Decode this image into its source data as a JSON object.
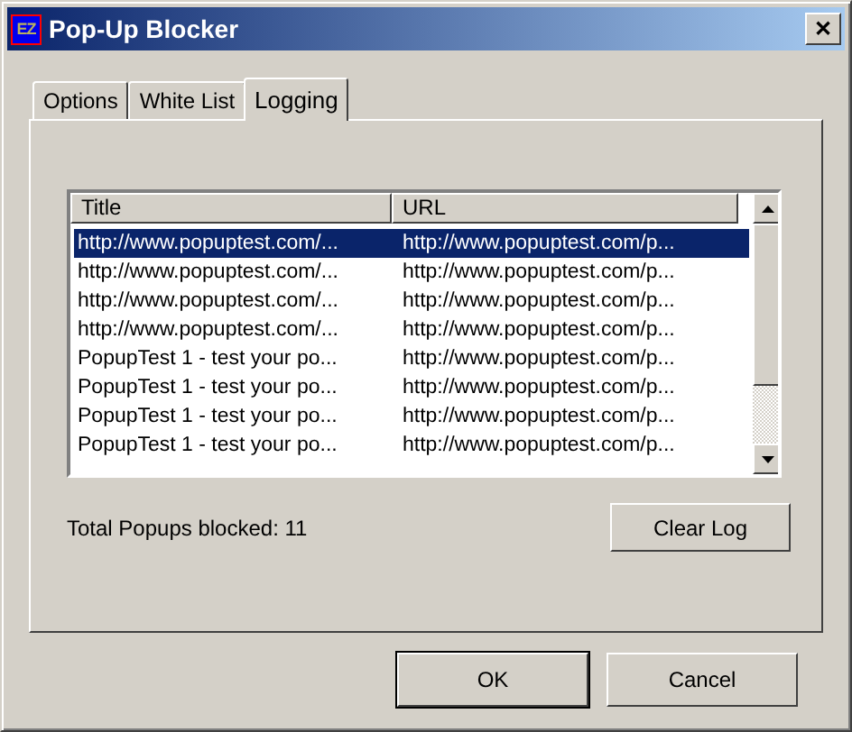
{
  "window": {
    "logo": "EZ",
    "title": "Pop-Up Blocker",
    "close": "✕"
  },
  "tabs": [
    {
      "label": "Options",
      "selected": false
    },
    {
      "label": "White List",
      "selected": false
    },
    {
      "label": "Logging",
      "selected": true
    }
  ],
  "table": {
    "columns": [
      "Title",
      "URL"
    ],
    "rows": [
      {
        "cells": [
          "http://www.popuptest.com/...",
          "http://www.popuptest.com/p..."
        ],
        "selected": true
      },
      {
        "cells": [
          "http://www.popuptest.com/...",
          "http://www.popuptest.com/p..."
        ],
        "selected": false
      },
      {
        "cells": [
          "http://www.popuptest.com/...",
          "http://www.popuptest.com/p..."
        ],
        "selected": false
      },
      {
        "cells": [
          "http://www.popuptest.com/...",
          "http://www.popuptest.com/p..."
        ],
        "selected": false
      },
      {
        "cells": [
          "PopupTest 1 - test your po...",
          "http://www.popuptest.com/p..."
        ],
        "selected": false
      },
      {
        "cells": [
          "PopupTest 1 - test your po...",
          "http://www.popuptest.com/p..."
        ],
        "selected": false
      },
      {
        "cells": [
          "PopupTest 1 - test your po...",
          "http://www.popuptest.com/p..."
        ],
        "selected": false
      },
      {
        "cells": [
          "PopupTest 1 - test your po...",
          "http://www.popuptest.com/p..."
        ],
        "selected": false
      }
    ]
  },
  "total": "Total Popups blocked: 11",
  "clear_button": "Clear Log",
  "buttons": [
    {
      "label": "OK",
      "default": true
    },
    {
      "label": "Cancel",
      "default": false
    }
  ]
}
